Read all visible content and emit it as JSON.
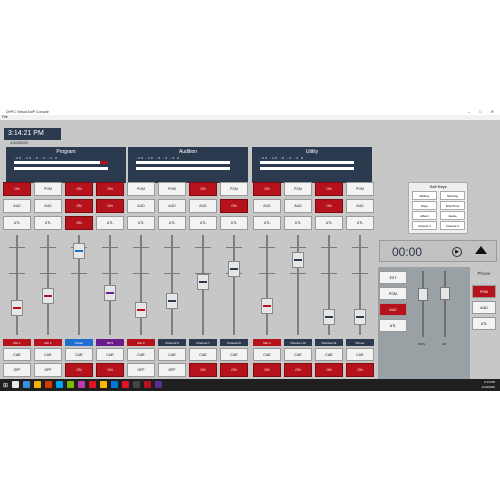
{
  "window": {
    "title": "DHPC Virtual AoIP Console",
    "menu": "File"
  },
  "clock": {
    "time": "3:14:21 PM",
    "date": "1/10/2020"
  },
  "buses": [
    {
      "name": "Program",
      "scale": "-20  -10  -6  -4  -2  0"
    },
    {
      "name": "Audition",
      "scale": "-20  -10  -6  -4  -2  0"
    },
    {
      "name": "Utility",
      "scale": "-20  -10  -6  -4  -2  0"
    }
  ],
  "strips": [
    {
      "on": "ON",
      "aud": "AUD",
      "utl": "UTL",
      "pgm_on": true,
      "aud_on": false,
      "utl_on": false,
      "label": "Mic 1",
      "label_color": "#b5121b",
      "cue": "CUE",
      "off": "OFF",
      "off_red": false,
      "fader_level": 0.22
    },
    {
      "on": "PGM",
      "aud": "AUD",
      "utl": "UTL",
      "pgm_on": false,
      "aud_on": false,
      "utl_on": false,
      "label": "Mic 2",
      "label_color": "#b5121b",
      "cue": "CUE",
      "off": "OFF",
      "off_red": false,
      "fader_level": 0.36
    },
    {
      "on": "ON",
      "aud": "ON",
      "utl": "ON",
      "pgm_on": true,
      "aud_on": true,
      "utl_on": true,
      "label": "Twitter",
      "label_color": "#1f6fd1",
      "cue": "CUE",
      "off": "ON",
      "off_red": true,
      "fader_level": 0.88
    },
    {
      "on": "ON",
      "aud": "ON",
      "utl": "UTL",
      "pgm_on": true,
      "aud_on": true,
      "utl_on": false,
      "label": "MP3",
      "label_color": "#6a1b8a",
      "cue": "CUE",
      "off": "ON",
      "off_red": true,
      "fader_level": 0.4
    },
    {
      "on": "PGM",
      "aud": "AUD",
      "utl": "UTL",
      "pgm_on": false,
      "aud_on": false,
      "utl_on": false,
      "label": "Mic 3",
      "label_color": "#b5121b",
      "cue": "CUE",
      "off": "OFF",
      "off_red": false,
      "fader_level": 0.2
    },
    {
      "on": "PGM",
      "aud": "AUD",
      "utl": "UTL",
      "pgm_on": false,
      "aud_on": false,
      "utl_on": false,
      "label": "Channel 6",
      "label_color": "#2b3a4e",
      "cue": "CUE",
      "off": "OFF",
      "off_red": false,
      "fader_level": 0.3
    },
    {
      "on": "ON",
      "aud": "AUD",
      "utl": "UTL",
      "pgm_on": true,
      "aud_on": false,
      "utl_on": false,
      "label": "Channel 7",
      "label_color": "#2b3a4e",
      "cue": "CUE",
      "off": "ON",
      "off_red": true,
      "fader_level": 0.52
    },
    {
      "on": "PGM",
      "aud": "ON",
      "utl": "UTL",
      "pgm_on": false,
      "aud_on": true,
      "utl_on": false,
      "label": "Channel 8",
      "label_color": "#2b3a4e",
      "cue": "CUE",
      "off": "ON",
      "off_red": true,
      "fader_level": 0.68
    },
    {
      "on": "ON",
      "aud": "AUD",
      "utl": "UTL",
      "pgm_on": true,
      "aud_on": false,
      "utl_on": false,
      "label": "Mic 4",
      "label_color": "#b5121b",
      "cue": "CUE",
      "off": "ON",
      "off_red": true,
      "fader_level": 0.25
    },
    {
      "on": "PGM",
      "aud": "AUD",
      "utl": "UTL",
      "pgm_on": false,
      "aud_on": false,
      "utl_on": false,
      "label": "Channel 10",
      "label_color": "#2b3a4e",
      "cue": "CUE",
      "off": "ON",
      "off_red": true,
      "fader_level": 0.78
    },
    {
      "on": "ON",
      "aud": "ON",
      "utl": "UTL",
      "pgm_on": true,
      "aud_on": true,
      "utl_on": false,
      "label": "Channel 11",
      "label_color": "#2b3a4e",
      "cue": "CUE",
      "off": "ON",
      "off_red": true,
      "fader_level": 0.12
    },
    {
      "on": "PGM",
      "aud": "AUD",
      "utl": "UTL",
      "pgm_on": false,
      "aud_on": false,
      "utl_on": false,
      "label": "Phone",
      "label_color": "#2b3a4e",
      "cue": "CUE",
      "off": "ON",
      "off_red": true,
      "fader_level": 0.12
    }
  ],
  "softkeys": {
    "title": "Soft Keys",
    "keys": [
      "Widney",
      "Morning",
      "Pepe",
      "DriveTime",
      "Album",
      "Jessie",
      "Closure 1",
      "Closure 2"
    ]
  },
  "timer": {
    "value": "00:00"
  },
  "monitor": {
    "buttons": [
      "EXT",
      "PGM",
      "AUD",
      "UTL"
    ],
    "selected": "AUD",
    "labels": [
      "MON",
      "HP"
    ],
    "levels": [
      0.7,
      0.72
    ]
  },
  "phone": {
    "title": "Phone",
    "buttons": [
      "PGM",
      "AUD",
      "UTL"
    ],
    "selected": "PGM"
  },
  "taskbar": {
    "time": "3:14 PM",
    "date": "1/10/2020",
    "icon_colors": [
      "#e8e8e8",
      "#3b8ede",
      "#f0b400",
      "#d83b01",
      "#00a4ef",
      "#7fba00",
      "#c239b3",
      "#e81123",
      "#ffb900",
      "#0078d7",
      "#e81123",
      "#444444",
      "#b5121b",
      "#5c2d91"
    ]
  }
}
